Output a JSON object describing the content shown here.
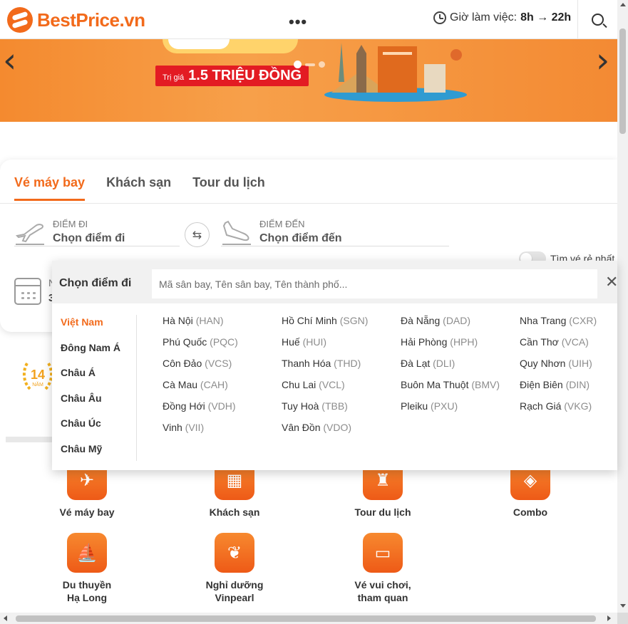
{
  "header": {
    "brand": "BestPrice.vn",
    "menu_dots": "•••",
    "hours_label": "Giờ làm việc:",
    "hours_value": "8h → 22h"
  },
  "banner": {
    "tag_small": "Trị giá",
    "tag_big": "1.5 TRIỆU ĐỒNG",
    "prev": "‹",
    "next": "›"
  },
  "booking": {
    "tabs": [
      {
        "label": "Vé máy bay",
        "active": true
      },
      {
        "label": "Khách sạn",
        "active": false
      },
      {
        "label": "Tour du lịch",
        "active": false
      }
    ],
    "from_label": "ĐIỂM ĐI",
    "from_value": "Chọn điểm đi",
    "to_label": "ĐIỂM ĐẾN",
    "to_value": "Chọn điểm đến",
    "date_fragment_1": "N",
    "date_fragment_2": "3",
    "cheap_toggle_label": "Tìm vé rẻ nhất"
  },
  "dropdown": {
    "title": "Chọn điểm đi",
    "placeholder": "Mã sân bay, Tên sân bay, Tên thành phố...",
    "close": "✕",
    "regions": [
      "Việt Nam",
      "Đông Nam Á",
      "Châu Á",
      "Châu Âu",
      "Châu Úc",
      "Châu Mỹ"
    ],
    "active_region": "Việt Nam",
    "cities": [
      {
        "name": "Hà Nội",
        "code": "(HAN)"
      },
      {
        "name": "Hồ Chí Minh",
        "code": "(SGN)"
      },
      {
        "name": "Đà Nẵng",
        "code": "(DAD)"
      },
      {
        "name": "Nha Trang",
        "code": "(CXR)"
      },
      {
        "name": "Phú Quốc",
        "code": "(PQC)"
      },
      {
        "name": "Huế",
        "code": "(HUI)"
      },
      {
        "name": "Hải Phòng",
        "code": "(HPH)"
      },
      {
        "name": "Cần Thơ",
        "code": "(VCA)"
      },
      {
        "name": "Côn Đảo",
        "code": "(VCS)"
      },
      {
        "name": "Thanh Hóa",
        "code": "(THD)"
      },
      {
        "name": "Đà Lạt",
        "code": "(DLI)"
      },
      {
        "name": "Quy Nhơn",
        "code": "(UIH)"
      },
      {
        "name": "Cà Mau",
        "code": "(CAH)"
      },
      {
        "name": "Chu Lai",
        "code": "(VCL)"
      },
      {
        "name": "Buôn Ma Thuột",
        "code": "(BMV)"
      },
      {
        "name": "Điện Biên",
        "code": "(DIN)"
      },
      {
        "name": "Đồng Hới",
        "code": "(VDH)"
      },
      {
        "name": "Tuy Hoà",
        "code": "(TBB)"
      },
      {
        "name": "Pleiku",
        "code": "(PXU)"
      },
      {
        "name": "Rạch Giá",
        "code": "(VKG)"
      },
      {
        "name": "Vinh",
        "code": "(VII)"
      },
      {
        "name": "Vân Đồn",
        "code": "(VDO)"
      }
    ]
  },
  "badge": {
    "number": "14",
    "text": "NĂM"
  },
  "services": [
    {
      "label": "Vé máy bay",
      "icon": "plane-icon"
    },
    {
      "label": "Khách sạn",
      "icon": "hotel-icon"
    },
    {
      "label": "Tour du lịch",
      "icon": "traveler-icon"
    },
    {
      "label": "Combo",
      "icon": "ticket-tag-icon"
    },
    {
      "label": "Du thuyền\nHạ Long",
      "icon": "boat-icon"
    },
    {
      "label": "Nghỉ dưỡng\nVinpearl",
      "icon": "vinpearl-icon"
    },
    {
      "label": "Vé vui chơi,\ntham quan",
      "icon": "ticket-icon"
    }
  ],
  "colors": {
    "accent": "#f26a1b",
    "tag_red": "#e31b23"
  }
}
